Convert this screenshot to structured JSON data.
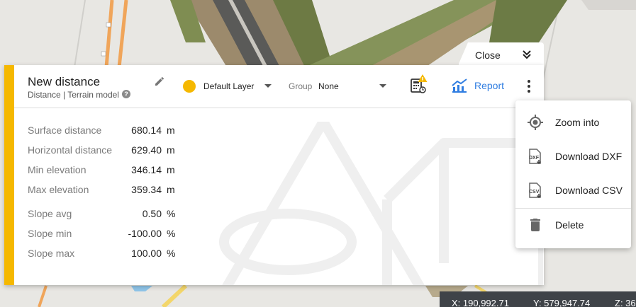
{
  "panel": {
    "title": "New distance",
    "subtitle": "Distance | Terrain model",
    "layer": {
      "label": "Default Layer",
      "color": "#f5b800"
    },
    "group": {
      "label": "Group",
      "value": "None"
    },
    "report_label": "Report",
    "close_label": "Close",
    "accent_color": "#f5b800",
    "stats": [
      {
        "label": "Surface distance",
        "value": "680.14",
        "unit": "m"
      },
      {
        "label": "Horizontal distance",
        "value": "629.40",
        "unit": "m"
      },
      {
        "label": "Min elevation",
        "value": "346.14",
        "unit": "m"
      },
      {
        "label": "Max elevation",
        "value": "359.34",
        "unit": "m"
      },
      {
        "label": "Slope avg",
        "value": "0.50",
        "unit": "%"
      },
      {
        "label": "Slope min",
        "value": "-100.00",
        "unit": "%"
      },
      {
        "label": "Slope max",
        "value": "100.00",
        "unit": "%"
      }
    ]
  },
  "menu": {
    "items": [
      {
        "label": "Zoom into",
        "icon": "target-icon"
      },
      {
        "label": "Download DXF",
        "icon": "dxf-file-icon"
      },
      {
        "label": "Download CSV",
        "icon": "csv-file-icon"
      },
      {
        "label": "Delete",
        "icon": "trash-icon"
      }
    ]
  },
  "coords": {
    "x": "X: 190,992.71",
    "y": "Y: 579,947.74",
    "z": "Z: 36"
  },
  "icons": {
    "edit": "pencil-icon",
    "help": "help-circle-icon",
    "calc": "calculator-warning-icon",
    "report": "chart-line-icon",
    "more": "more-vertical-icon",
    "close": "double-chevron-down-icon"
  }
}
